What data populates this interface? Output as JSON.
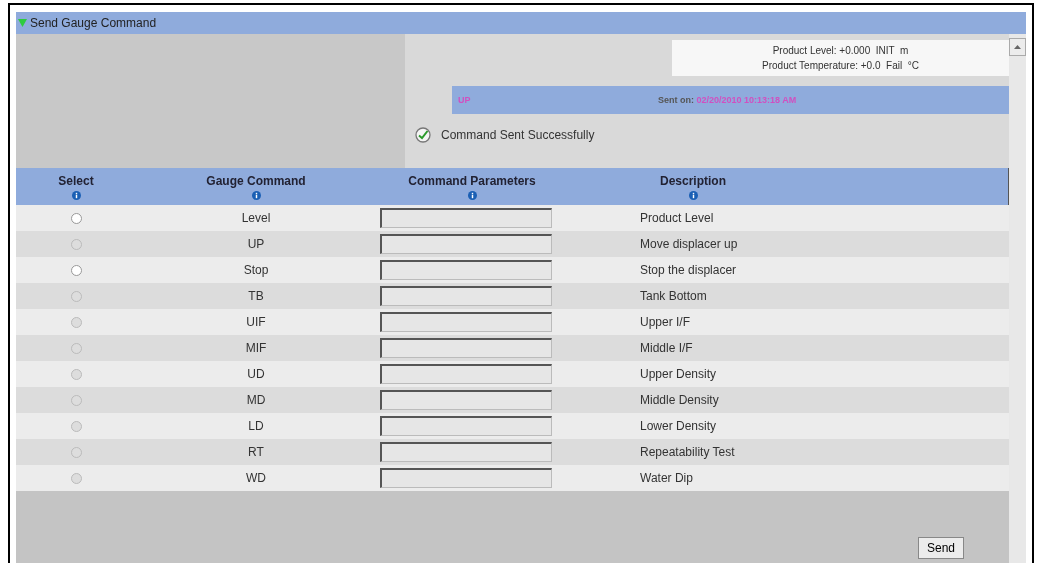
{
  "panel": {
    "title": "Send Gauge Command"
  },
  "readings": [
    "Product Level: +0.000  INIT  m",
    "Product Temperature: +0.0  Fail  °C"
  ],
  "last_command": {
    "command": "UP",
    "sent_label": "Sent on:",
    "sent_time": "02/20/2010 10:13:18 AM"
  },
  "status": {
    "message": "Command Sent Successfully"
  },
  "table": {
    "columns": [
      "Select",
      "Gauge Command",
      "Command Parameters",
      "Description"
    ],
    "rows": [
      {
        "selected": false,
        "disabled": false,
        "command": "Level",
        "description": "Product Level"
      },
      {
        "selected": false,
        "disabled": true,
        "command": "UP",
        "description": "Move displacer up"
      },
      {
        "selected": false,
        "disabled": false,
        "command": "Stop",
        "description": "Stop the displacer"
      },
      {
        "selected": false,
        "disabled": true,
        "command": "TB",
        "description": "Tank Bottom"
      },
      {
        "selected": false,
        "disabled": true,
        "command": "UIF",
        "description": "Upper I/F"
      },
      {
        "selected": false,
        "disabled": true,
        "command": "MIF",
        "description": "Middle I/F"
      },
      {
        "selected": false,
        "disabled": true,
        "command": "UD",
        "description": "Upper Density"
      },
      {
        "selected": false,
        "disabled": true,
        "command": "MD",
        "description": "Middle Density"
      },
      {
        "selected": false,
        "disabled": true,
        "command": "LD",
        "description": "Lower Density"
      },
      {
        "selected": false,
        "disabled": true,
        "command": "RT",
        "description": "Repeatability Test"
      },
      {
        "selected": false,
        "disabled": true,
        "command": "WD",
        "description": "Water Dip"
      }
    ]
  },
  "buttons": [
    "Send"
  ]
}
